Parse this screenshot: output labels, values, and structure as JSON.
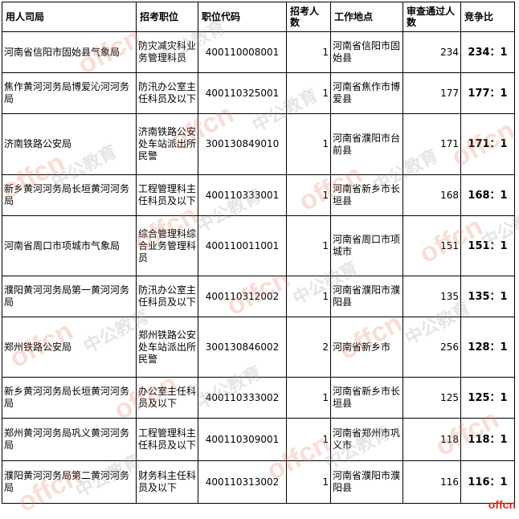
{
  "headers": {
    "employer": "用人司局",
    "position": "招考职位",
    "code": "职位代码",
    "quota": "招考人数",
    "location": "工作地点",
    "passed": "审查通过人数",
    "ratio": "竞争比"
  },
  "rows": [
    {
      "employer": "河南省信阳市固始县气象局",
      "position": "防灾减灾科业务管理科员",
      "code": "400110008001",
      "quota": "1",
      "location": "河南省信阳市固始县",
      "passed": "234",
      "ratio": "234：1"
    },
    {
      "employer": "焦作黄河河务局博爱沁河河务局",
      "position": "防汛办公室主任科员及以下",
      "code": "400110325001",
      "quota": "1",
      "location": "河南省焦作市博爱县",
      "passed": "177",
      "ratio": "177：1"
    },
    {
      "employer": "济南铁路公安局",
      "position": "济南铁路公安处车站派出所民警",
      "code": "300130849010",
      "quota": "1",
      "location": "河南省濮阳市台前县",
      "passed": "171",
      "ratio": "171：1"
    },
    {
      "employer": "新乡黄河河务局长垣黄河河务局",
      "position": "工程管理科主任科员及以下",
      "code": "400110333001",
      "quota": "1",
      "location": "河南省新乡市长垣县",
      "passed": "168",
      "ratio": "168：1"
    },
    {
      "employer": "河南省周口市项城市气象局",
      "position": "综合管理科综合业务管理科员",
      "code": "400110011001",
      "quota": "1",
      "location": "河南省周口市项城市",
      "passed": "151",
      "ratio": "151：1"
    },
    {
      "employer": "濮阳黄河河务局第一黄河河务局",
      "position": "防汛办公室主任科员及以下",
      "code": "400110312002",
      "quota": "1",
      "location": "河南省濮阳市濮阳县",
      "passed": "135",
      "ratio": "135：1"
    },
    {
      "employer": "郑州铁路公安局",
      "position": "郑州铁路公安处车站派出所民警",
      "code": "300130846002",
      "quota": "2",
      "location": "河南省新乡市",
      "passed": "256",
      "ratio": "128：1"
    },
    {
      "employer": "新乡黄河河务局长垣黄河河务局",
      "position": "办公室主任科员及以下",
      "code": "400110333002",
      "quota": "1",
      "location": "河南省新乡市长垣县",
      "passed": "125",
      "ratio": "125：1"
    },
    {
      "employer": "郑州黄河河务局巩义黄河河务局",
      "position": "工程管理科主任科员及以下",
      "code": "400110309001",
      "quota": "1",
      "location": "河南省郑州市巩义市",
      "passed": "118",
      "ratio": "118：1"
    },
    {
      "employer": "濮阳黄河河务局第二黄河河务局",
      "position": "财务科主任科员及以下",
      "code": "400110313002",
      "quota": "1",
      "location": "河南省濮阳市濮阳县",
      "passed": "116",
      "ratio": "116：1"
    }
  ],
  "watermark": {
    "logo": "offcn",
    "text": "中公教育"
  },
  "brand_mark": "offcn"
}
